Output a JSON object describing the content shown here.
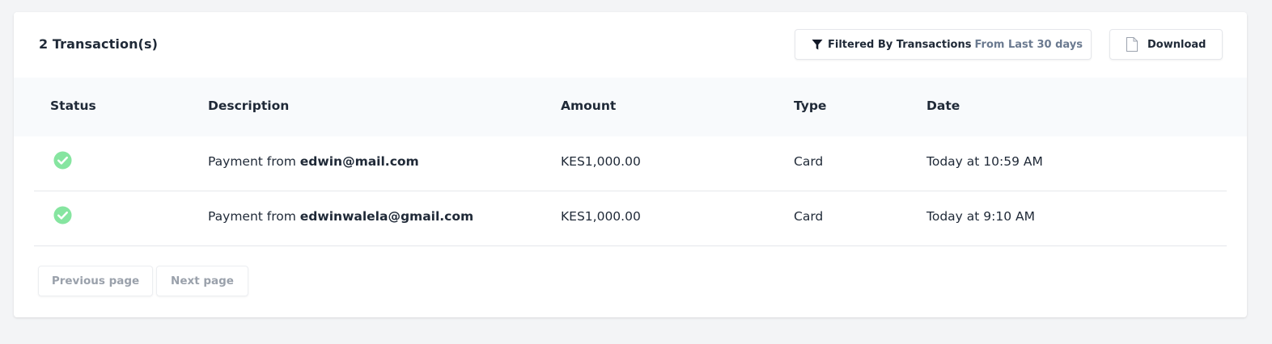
{
  "header": {
    "transaction_count": "2 Transaction(s)",
    "filter_button": {
      "label": "Filtered By Transactions",
      "range": "From Last 30 days",
      "icon": "filter-icon"
    },
    "download_button": {
      "label": "Download",
      "icon": "file-icon"
    }
  },
  "table": {
    "columns": [
      "Status",
      "Description",
      "Amount",
      "Type",
      "Date"
    ],
    "rows": [
      {
        "status": "success",
        "description_prefix": "Payment from",
        "description_email": "edwin@mail.com",
        "amount": "KES1,000.00",
        "type": "Card",
        "date": "Today at 10:59 AM"
      },
      {
        "status": "success",
        "description_prefix": "Payment from",
        "description_email": "edwinwalela@gmail.com",
        "amount": "KES1,000.00",
        "type": "Card",
        "date": "Today at 9:10 AM"
      }
    ]
  },
  "pagination": {
    "previous_label": "Previous page",
    "next_label": "Next page"
  },
  "colors": {
    "success": "#86e5a0",
    "muted_text": "#6b7a90",
    "header_bg": "#f8fafc"
  }
}
